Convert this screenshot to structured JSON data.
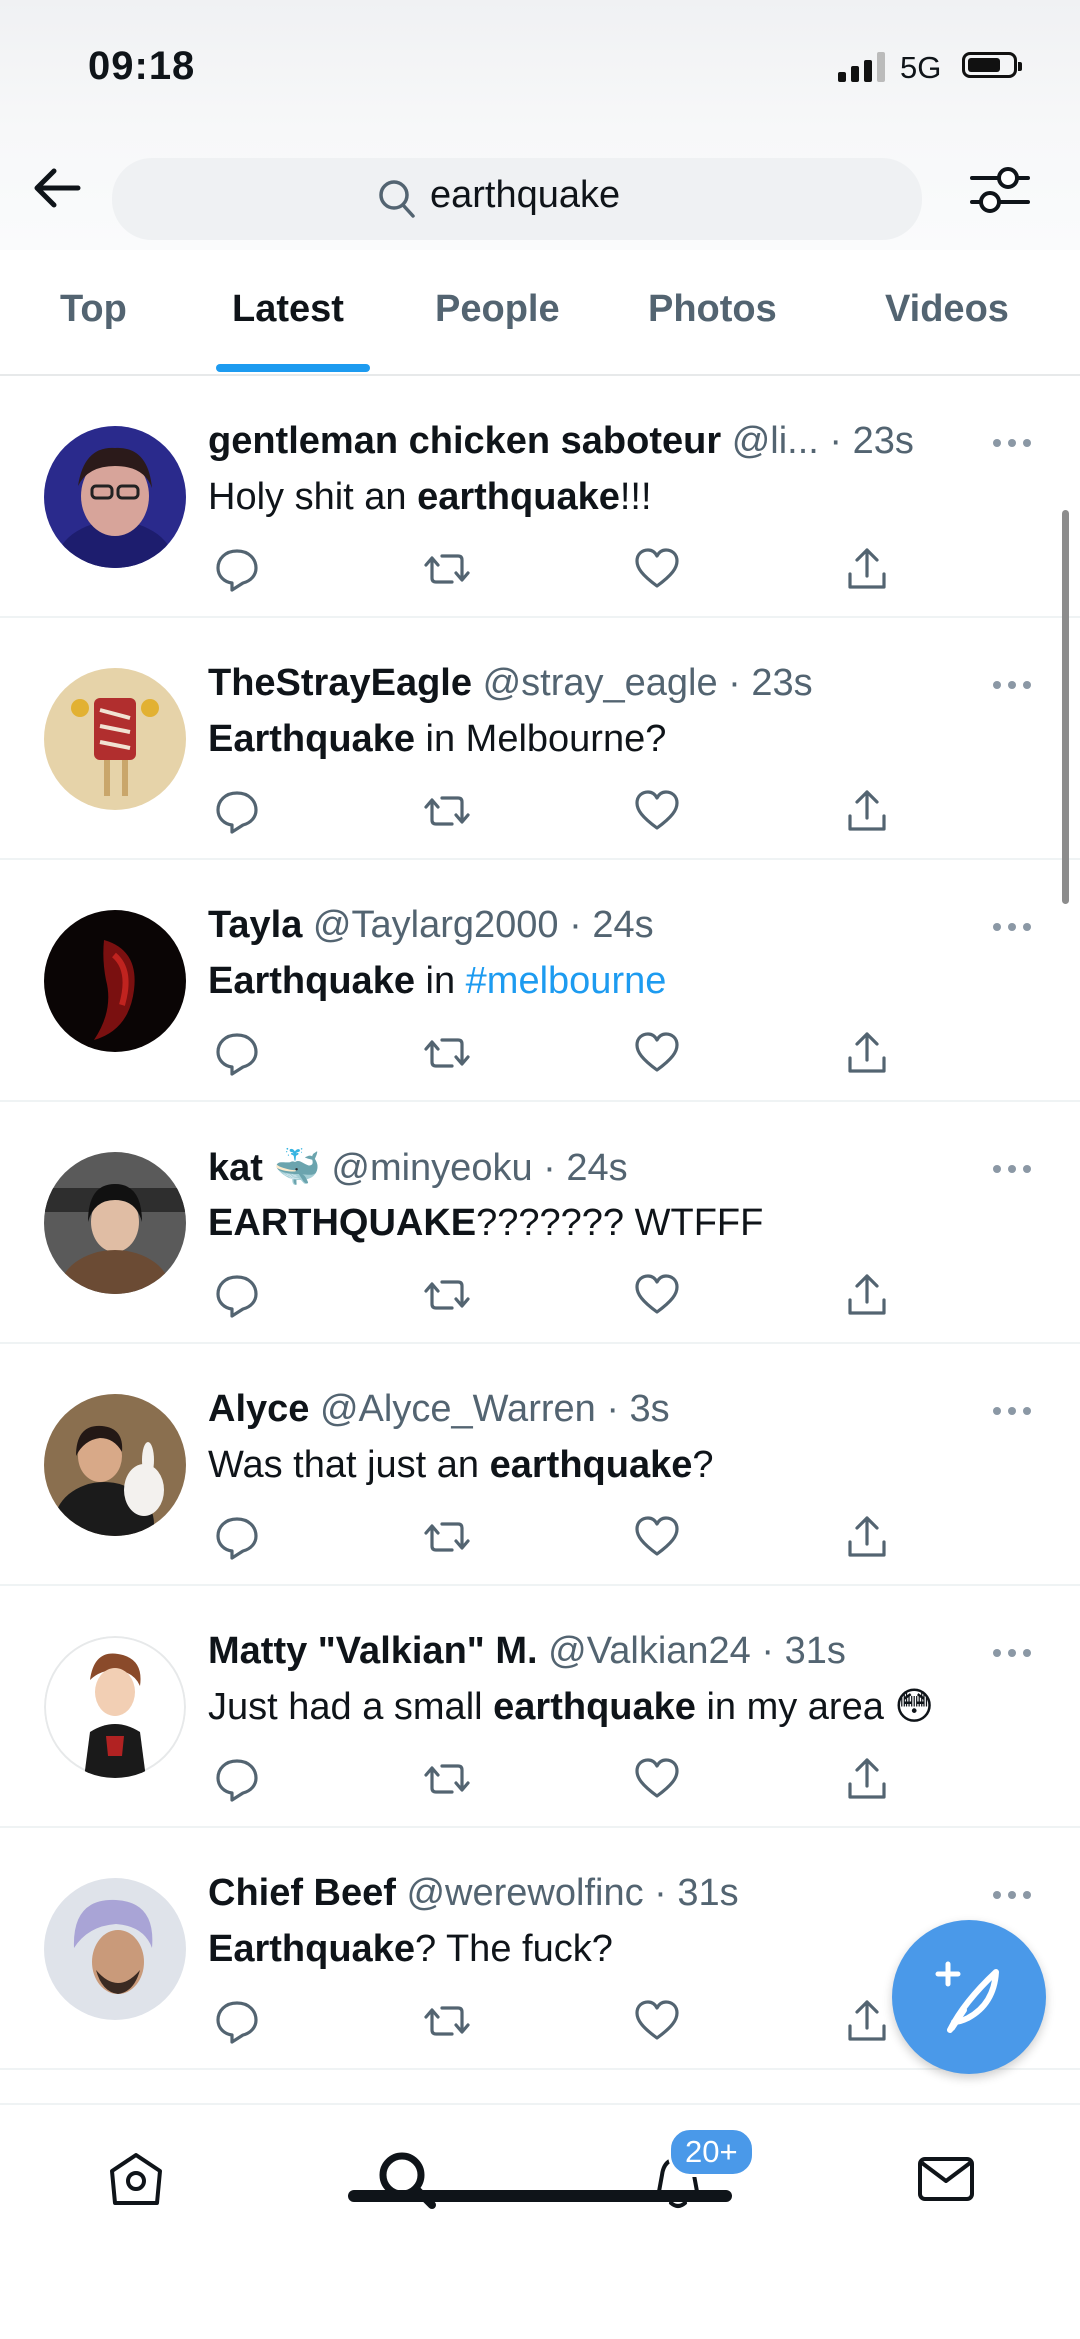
{
  "status": {
    "time": "09:18",
    "network": "5G"
  },
  "search": {
    "query": "earthquake"
  },
  "tabs": [
    {
      "label": "Top",
      "active": false
    },
    {
      "label": "Latest",
      "active": true
    },
    {
      "label": "People",
      "active": false
    },
    {
      "label": "Photos",
      "active": false
    },
    {
      "label": "Videos",
      "active": false
    }
  ],
  "tweets": [
    {
      "name": "gentleman chicken saboteur",
      "handle": "@li...",
      "time": "23s",
      "text_before": "Holy shit an ",
      "text_bold": "earthquake",
      "text_after": "!!!",
      "text_tag": ""
    },
    {
      "name": "TheStrayEagle",
      "handle": "@stray_eagle",
      "time": "23s",
      "text_before": "",
      "text_bold": "Earthquake",
      "text_after": " in Melbourne?",
      "text_tag": ""
    },
    {
      "name": "Tayla",
      "handle": "@Taylarg2000",
      "time": "24s",
      "text_before": "",
      "text_bold": "Earthquake",
      "text_after": " in ",
      "text_tag": "#melbourne"
    },
    {
      "name": "kat",
      "handle": "@minyeoku",
      "time": "24s",
      "text_before": "",
      "text_bold": "EARTHQUAKE",
      "text_after": "??????? WTFFF",
      "text_tag": ""
    },
    {
      "name": "Alyce",
      "handle": "@Alyce_Warren",
      "time": "3s",
      "text_before": "Was that just an ",
      "text_bold": "earthquake",
      "text_after": "?",
      "text_tag": ""
    },
    {
      "name": "Matty \"Valkian\" M.",
      "handle": "@Valkian24",
      "time": "31s",
      "text_before": "Just had a small ",
      "text_bold": "earthquake",
      "text_after": " in my area 😳",
      "text_tag": ""
    },
    {
      "name": "Chief Beef",
      "handle": "@werewolfinc",
      "time": "31s",
      "text_before": "",
      "text_bold": "Earthquake",
      "text_after": "? The fuck?",
      "text_tag": ""
    }
  ],
  "notifications": {
    "badge": "20+"
  },
  "colors": {
    "accent": "#1d9bf0",
    "fab": "#4a99e9",
    "secondary_text": "#536471"
  },
  "icons": {
    "header": [
      "back-arrow-icon",
      "search-icon",
      "filter-icon"
    ],
    "actions": [
      "reply-icon",
      "retweet-icon",
      "like-icon",
      "share-icon"
    ],
    "nav": [
      "home-icon",
      "explore-search-icon",
      "notifications-bell-icon",
      "messages-envelope-icon"
    ],
    "fab": "compose-tweet-icon"
  }
}
